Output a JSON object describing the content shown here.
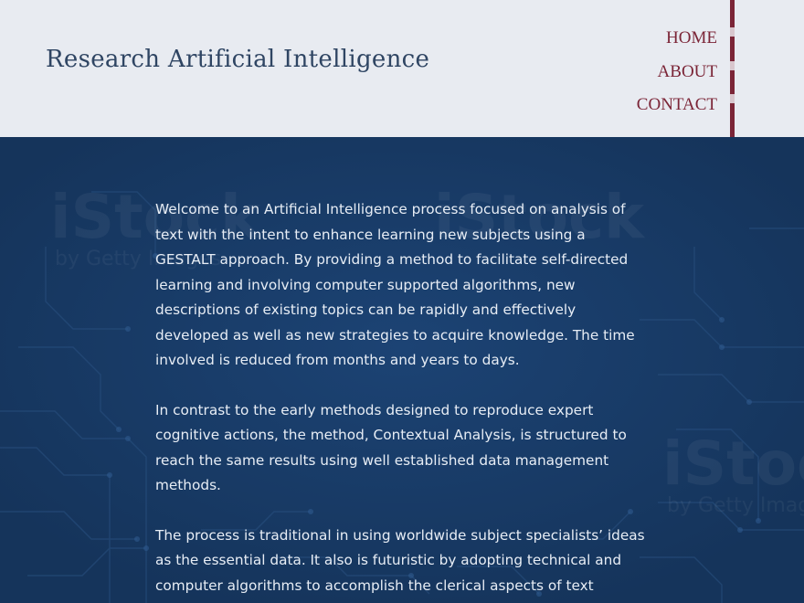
{
  "header": {
    "title": "Research Artificial Intelligence"
  },
  "nav": {
    "items": [
      {
        "label": "HOME"
      },
      {
        "label": "ABOUT"
      },
      {
        "label": "CONTACT"
      }
    ]
  },
  "hero": {
    "watermarks": [
      "iStock",
      "iStock",
      "iStock",
      "by Getty Images",
      "by Getty Images"
    ],
    "paragraphs": [
      "Welcome to an Artificial Intelligence process focused on analysis of text with the intent to enhance learning new subjects using a GESTALT approach.  By providing a method to facilitate self-directed learning and involving computer supported algorithms, new descriptions of existing topics can be rapidly and effectively developed as well as new strategies to acquire knowledge.  The time involved is reduced from months and years to days.",
      "In contrast to the early methods designed to reproduce expert cognitive actions, the method, Contextual Analysis, is structured to reach the same results using well established data management methods.",
      "The process is traditional in using worldwide subject specialists’ ideas as the essential data.  It also is futuristic by adopting technical and computer algorithms to accomplish the clerical aspects of text"
    ]
  },
  "colors": {
    "header_bg": "#e8ebf1",
    "title": "#2f4563",
    "nav_accent": "#7b2537",
    "hero_bg": "#183a64",
    "hero_text": "#e7edf5"
  }
}
